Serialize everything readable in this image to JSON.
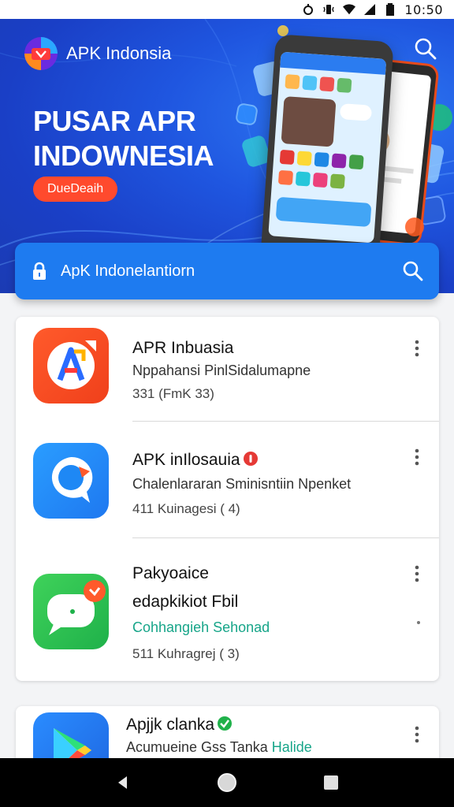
{
  "status_bar": {
    "time": "10:50",
    "icons": [
      "notification-icon",
      "vibrate-icon",
      "wifi-icon",
      "signal-icon",
      "battery-icon"
    ]
  },
  "header": {
    "brand": "APK Indonsia",
    "hero_title_line1": "PUSAR APR",
    "hero_title_line2": "INDOWNESIA",
    "cta_label": "DueDeaih",
    "search_icon": "search-icon"
  },
  "search": {
    "text": "ApK Indonelantiorn",
    "lock_icon": "lock-icon",
    "search_icon": "search-icon"
  },
  "apps": [
    {
      "name": "APR Inbuasia",
      "subtitle": "Nppahansi PinlSidalumapne",
      "meta": "331 (FmK 33)",
      "icon": "apk-a-icon"
    },
    {
      "name": "APK inIlosauia",
      "subtitle": "Chalenlararan Sminisntiin Npenket",
      "meta": "411 Kuinagesi ( 4)",
      "icon": "chat-bubble-icon"
    },
    {
      "name_line1": "Pakyoaice",
      "name_line2": "edapkikiot Fbil",
      "subtitle": "Cohhangieh Sehonad",
      "meta": "511 Kuhragrej ( 3)",
      "icon": "message-icon"
    },
    {
      "name": "Apjjk clanka",
      "subtitle_prefix": "Acumueine Gss Tanka ",
      "subtitle_suffix": "Halide",
      "icon": "play-store-icon"
    }
  ],
  "colors": {
    "hero_blue": "#1f56e0",
    "search_blue": "#1e7bf0",
    "cta_orange": "#ff4a2d",
    "teal_text": "#17a589"
  },
  "nav": {
    "back": "back-icon",
    "home": "home-icon",
    "recents": "recents-icon"
  }
}
